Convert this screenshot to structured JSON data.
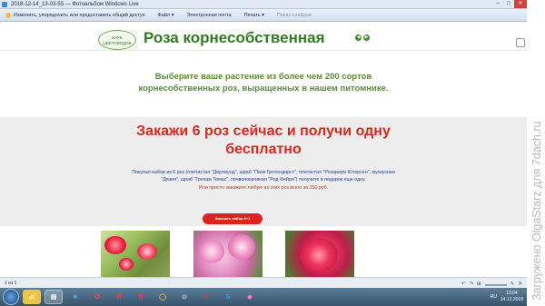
{
  "window": {
    "title": "2018-12-14_13-03-55 — Фотоальбом Windows Live",
    "controls": [
      "–",
      "□",
      "✕"
    ]
  },
  "menubar": {
    "hint": "Изменить, упорядочить или предоставить общий доступ",
    "items": [
      "Файл ▾",
      "Электронная почта",
      "Печать ▾",
      "Показ слайдов"
    ]
  },
  "site": {
    "logo_text": "КЛУБ ЦВЕТОВОДОВ",
    "title": "Роза корнесобственная",
    "intro": "Выберите ваше растение из более чем 200 сортов корнесобственных роз, выращенных в нашем питомнике."
  },
  "promo": {
    "headline": "Закажи 6 роз сейчас и получи одну бесплатно",
    "description": "Покупая набор из 6 роз (плетистая \"Дортмунд\", шраб \"Пинк Гротендорст\", плетистая \"Розариум Ютерсен\", мускусная \"Дизия\", шраб \"Грехам Томас\", почвопокровная \"Ред Фейри\") получите в подарок еще одну.",
    "note": "Или просто закажите любую из этих роз всего за 150 руб.",
    "button": "Заказать набор 6+1"
  },
  "statusbar": {
    "counter": "1 из 1",
    "controls": [
      "↶",
      "↷",
      "⊞",
      "✎",
      "✕"
    ]
  },
  "taskbar": {
    "apps": [
      "📁",
      "▤",
      "e",
      "O",
      "Я",
      "Я",
      "◯",
      "⊙",
      "Y",
      "S",
      "◆"
    ],
    "tray_lang": "RU",
    "clock_time": "13:04",
    "clock_date": "14.12.2018"
  },
  "watermark": "Загружено OlgaStarz для 7dach.ru"
}
